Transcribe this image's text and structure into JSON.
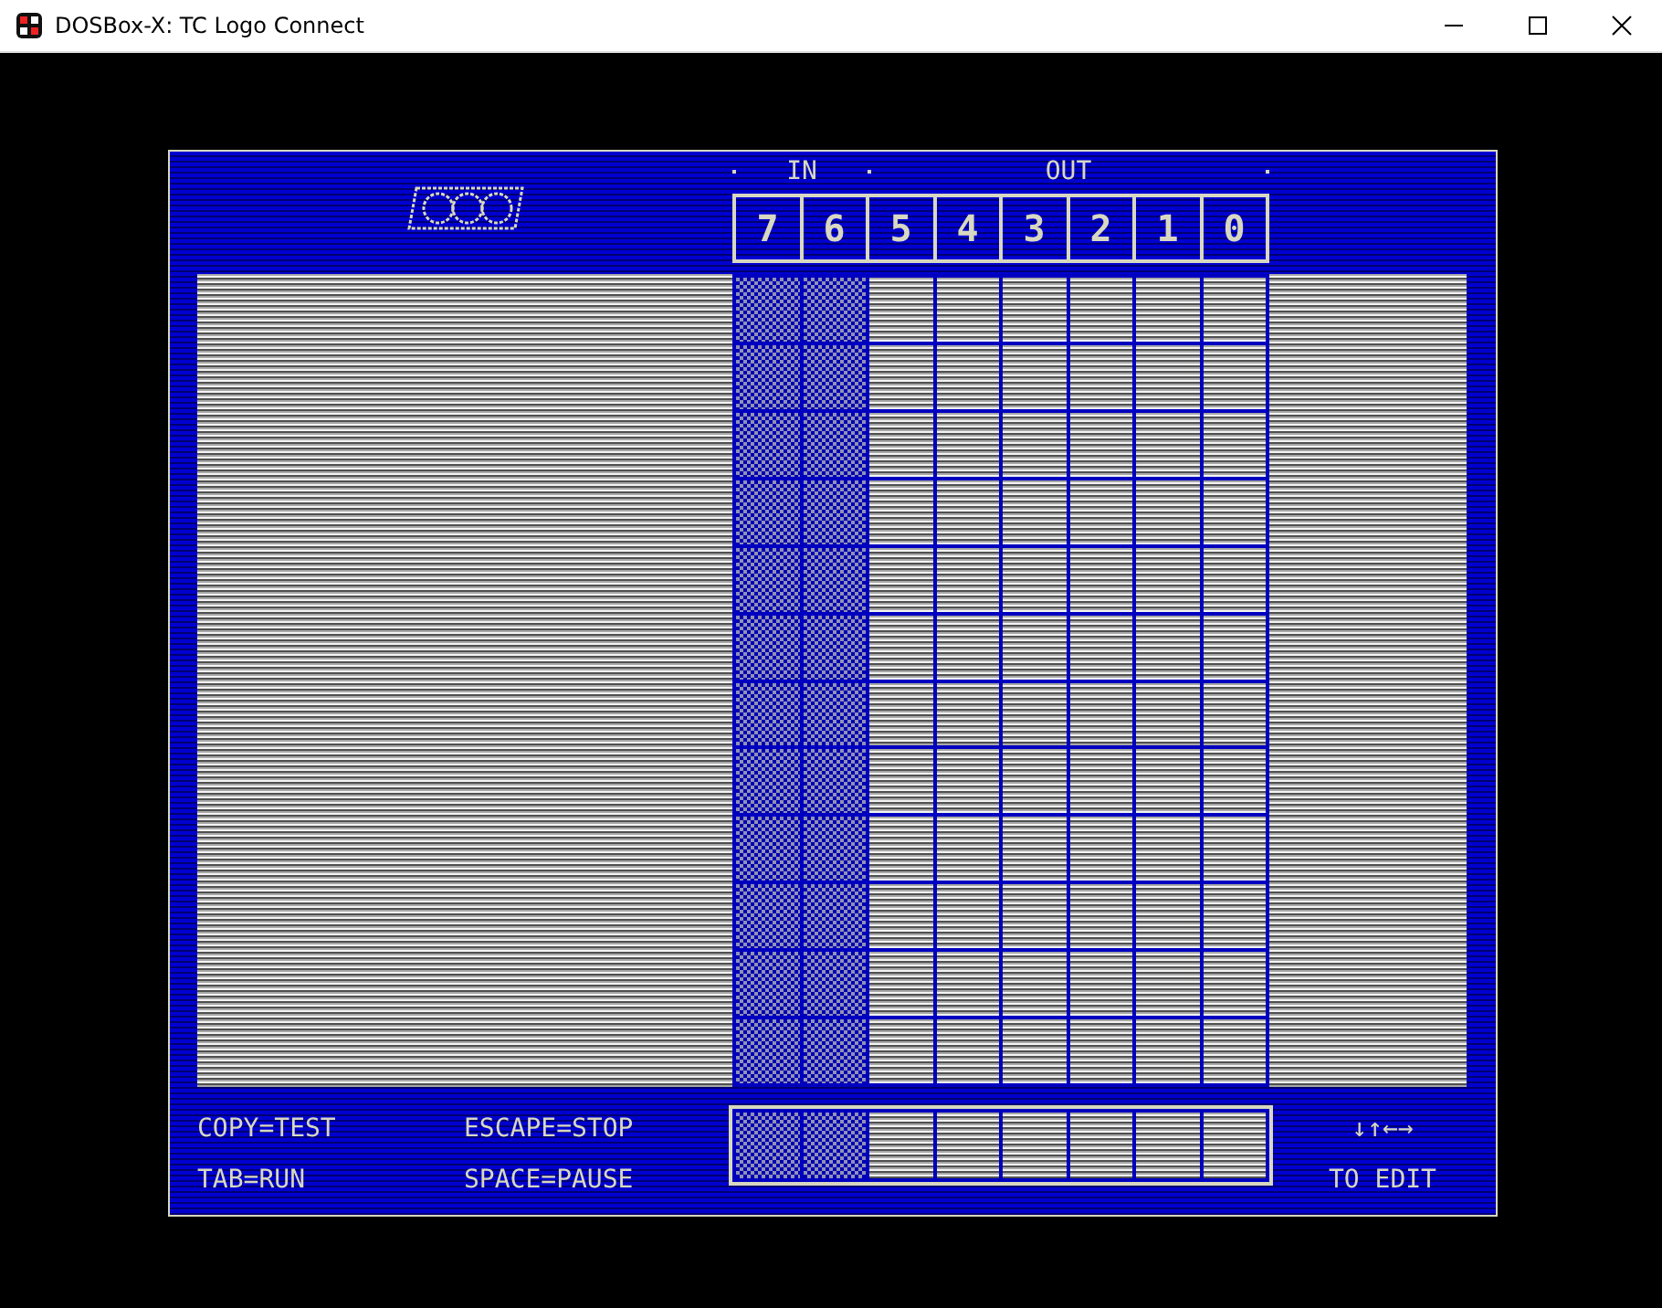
{
  "window": {
    "title": "DOSBox-X: TC Logo Connect"
  },
  "header": {
    "in_label": "IN",
    "out_label": "OUT"
  },
  "bits": [
    {
      "label": "7",
      "kind": "input"
    },
    {
      "label": "6",
      "kind": "input"
    },
    {
      "label": "5",
      "kind": "output"
    },
    {
      "label": "4",
      "kind": "output"
    },
    {
      "label": "3",
      "kind": "output"
    },
    {
      "label": "2",
      "kind": "output"
    },
    {
      "label": "1",
      "kind": "output"
    },
    {
      "label": "0",
      "kind": "output"
    }
  ],
  "footer": {
    "keys": [
      "COPY=TEST",
      "ESCAPE=STOP",
      "TAB=RUN",
      "SPACE=PAUSE"
    ],
    "arrows": "↓↑←→",
    "edit_hint": "TO EDIT"
  }
}
